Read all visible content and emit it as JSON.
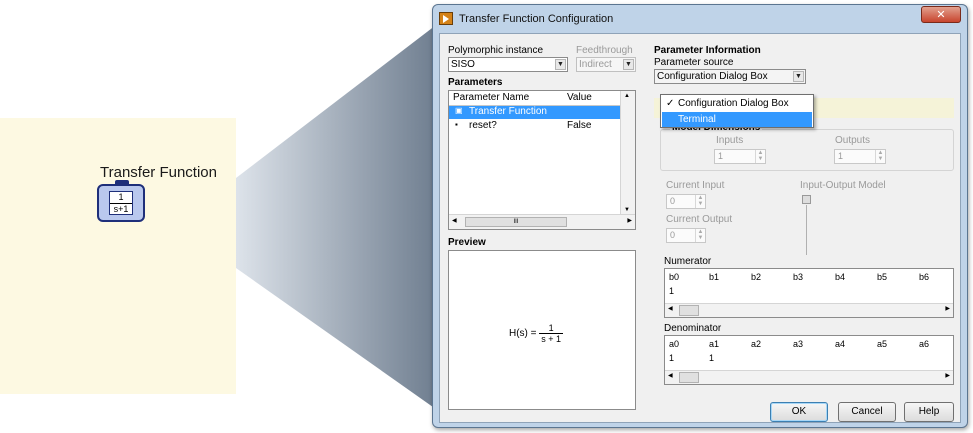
{
  "block_diagram": {
    "node_label": "Transfer Function",
    "icon_numerator": "1",
    "icon_denominator": "s+1"
  },
  "dialog": {
    "title": "Transfer Function Configuration",
    "close_glyph": "✕",
    "polymorphic": {
      "label": "Polymorphic instance",
      "value": "SISO"
    },
    "feedthrough": {
      "label": "Feedthrough",
      "value": "Indirect"
    },
    "parameters": {
      "heading": "Parameters",
      "columns": [
        "Parameter Name",
        "Value"
      ],
      "rows": [
        {
          "name": "Transfer Function",
          "value": "",
          "selected": true
        },
        {
          "name": "reset?",
          "value": "False",
          "selected": false
        }
      ],
      "scroll_thumb_glyph": "III"
    },
    "preview": {
      "heading": "Preview",
      "lhs": "H(s) = ",
      "numerator": "1",
      "denominator": "s + 1"
    },
    "param_info": {
      "heading": "Parameter Information",
      "source_label": "Parameter source",
      "source_value": "Configuration Dialog Box",
      "dropdown_options": [
        {
          "label": "Configuration Dialog Box",
          "checked": true,
          "highlighted": false
        },
        {
          "label": "Terminal",
          "checked": false,
          "highlighted": true
        }
      ],
      "check_glyph": "✓"
    },
    "model_dims": {
      "heading": "Model Dimensions",
      "inputs_label": "Inputs",
      "inputs_value": "1",
      "outputs_label": "Outputs",
      "outputs_value": "1"
    },
    "current_input": {
      "label": "Current Input",
      "value": "0"
    },
    "current_output": {
      "label": "Current Output",
      "value": "0"
    },
    "io_model_label": "Input-Output Model",
    "numerator": {
      "label": "Numerator",
      "headers": [
        "b0",
        "b1",
        "b2",
        "b3",
        "b4",
        "b5",
        "b6"
      ],
      "values": [
        "1",
        "",
        "",
        "",
        "",
        "",
        ""
      ]
    },
    "denominator": {
      "label": "Denominator",
      "headers": [
        "a0",
        "a1",
        "a2",
        "a3",
        "a4",
        "a5",
        "a6"
      ],
      "values": [
        "1",
        "1",
        "",
        "",
        "",
        "",
        ""
      ]
    },
    "buttons": {
      "ok": "OK",
      "cancel": "Cancel",
      "help": "Help"
    }
  }
}
